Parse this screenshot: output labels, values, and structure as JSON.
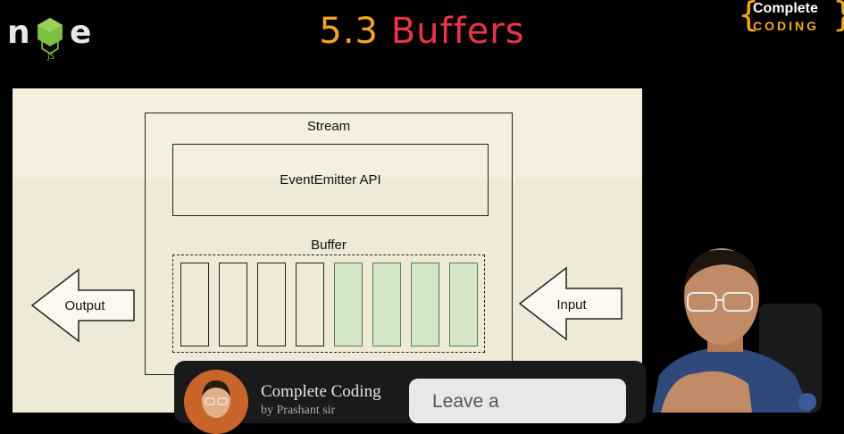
{
  "header": {
    "title_number": "5.3",
    "title_word": "Buffers",
    "brand_line1": "Complete",
    "brand_line2": "CODING"
  },
  "diagram": {
    "stream_label": "Stream",
    "event_emitter_label": "EventEmitter API",
    "buffer_label": "Buffer",
    "output_label": "Output",
    "input_label": "Input",
    "empty_cells": 4,
    "filled_cells": 4
  },
  "overlay": {
    "channel_name": "Complete Coding",
    "channel_sub": "by Prashant sir",
    "comment_placeholder": "Leave a"
  },
  "colors": {
    "title_number": "#f5a623",
    "title_word": "#e8344a",
    "slide_bg": "#f5efdf",
    "filled_cell": "#d3e7c6"
  }
}
